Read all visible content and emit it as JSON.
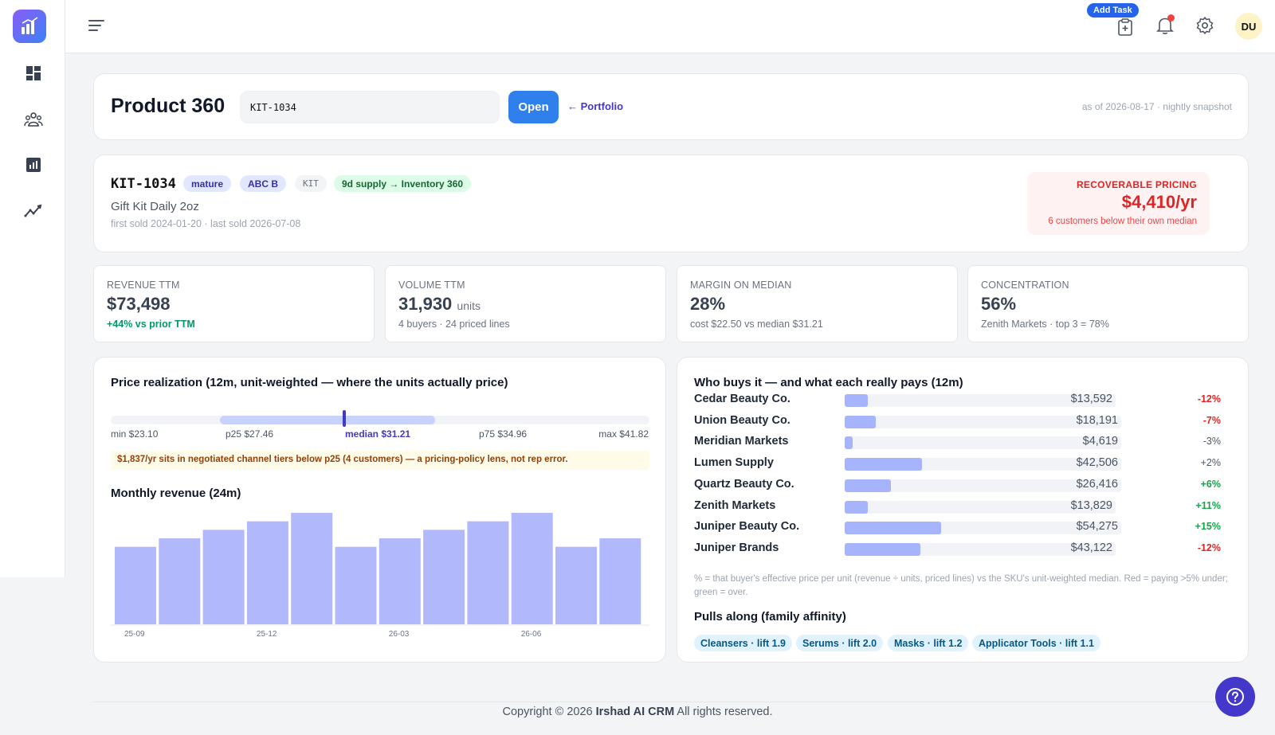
{
  "topbar": {
    "add_task_label": "Add Task",
    "avatar_initials": "DU"
  },
  "header": {
    "title": "Product 360",
    "sku_input_value": "KIT-1034",
    "open_label": "Open",
    "back_label": "← Portfolio",
    "snapshot": "as of 2026-08-17 · nightly snapshot"
  },
  "product": {
    "sku": "KIT-1034",
    "badges": [
      {
        "label": "mature"
      },
      {
        "label": "ABC B"
      },
      {
        "label": "KIT"
      },
      {
        "label": "9d supply → Inventory 360"
      }
    ],
    "name": "Gift Kit Daily 2oz",
    "dates": "first sold 2024-01-20 · last sold 2026-07-08",
    "recoverable": {
      "label": "RECOVERABLE PRICING",
      "value": "$4,410/yr",
      "sub": "6 customers below their own median"
    }
  },
  "kpis": [
    {
      "label": "REVENUE TTM",
      "value": "$73,498",
      "unit": "",
      "sub": "+44% vs prior TTM"
    },
    {
      "label": "VOLUME TTM",
      "value": "31,930",
      "unit": "units",
      "sub": "4 buyers · 24 priced lines"
    },
    {
      "label": "MARGIN ON MEDIAN",
      "value": "28%",
      "unit": "",
      "sub": "cost $22.50 vs median $31.21"
    },
    {
      "label": "CONCENTRATION",
      "value": "56%",
      "unit": "",
      "sub": "Zenith Markets · top 3 = 78%"
    }
  ],
  "price_realization": {
    "title": "Price realization (12m, unit-weighted — where the units actually price)",
    "min": "min $23.10",
    "p25": "p25 $27.46",
    "median": "median $31.21",
    "p75": "p75 $34.96",
    "max": "max $41.82",
    "note": "$1,837/yr sits in negotiated channel tiers below p25 (4 customers) — a pricing-policy lens, not rep error."
  },
  "chart_data": {
    "type": "bar",
    "title": "Monthly revenue (24m)",
    "categories": [
      "25-09",
      "25-10",
      "25-11",
      "25-12",
      "26-01",
      "26-02",
      "26-03",
      "26-04",
      "26-05",
      "26-06",
      "26-07",
      "26-08"
    ],
    "tick_labels": [
      "25-09",
      "25-12",
      "26-03",
      "26-06"
    ],
    "values": [
      8,
      9,
      10,
      11,
      12,
      8,
      9,
      10,
      11,
      12,
      8,
      9
    ],
    "ylim": [
      0,
      12
    ],
    "color": "#b1b8fb"
  },
  "buyers": {
    "title": "Who buys it — and what each really pays (12m)",
    "rows": [
      {
        "name": "Cedar Beauty Co.",
        "amount": "$13,592",
        "pct": "-12%",
        "share": 0.06
      },
      {
        "name": "Union Beauty Co.",
        "amount": "$18,191",
        "pct": "-7%",
        "share": 0.08
      },
      {
        "name": "Meridian Markets",
        "amount": "$4,619",
        "pct": "-3%",
        "share": 0.02
      },
      {
        "name": "Lumen Supply",
        "amount": "$42,506",
        "pct": "+2%",
        "share": 0.2
      },
      {
        "name": "Quartz Beauty Co.",
        "amount": "$26,416",
        "pct": "+6%",
        "share": 0.12
      },
      {
        "name": "Zenith Markets",
        "amount": "$13,829",
        "pct": "+11%",
        "share": 0.06
      },
      {
        "name": "Juniper Beauty Co.",
        "amount": "$54,275",
        "pct": "+15%",
        "share": 0.25
      },
      {
        "name": "Juniper Brands",
        "amount": "$43,122",
        "pct": "-12%",
        "share": 0.2
      }
    ],
    "legend": "% = that buyer's effective price per unit (revenue ÷ units, priced lines) vs the SKU's unit-weighted median. Red = paying >5% under; green = over.",
    "affinity_title": "Pulls along (family affinity)",
    "affinity": [
      {
        "label": "Cleansers · lift 1.9"
      },
      {
        "label": "Serums · lift 2.0"
      },
      {
        "label": "Masks · lift 1.2"
      },
      {
        "label": "Applicator Tools · lift 1.1"
      }
    ]
  },
  "footer": {
    "prefix": "Copyright © 2026",
    "brand": "Irshad AI CRM",
    "suffix": "All rights reserved."
  },
  "colors": {
    "accent": "#2f80ed",
    "indigo": "#4338ca",
    "negative": "#dc2626",
    "positive": "#16a34a"
  }
}
